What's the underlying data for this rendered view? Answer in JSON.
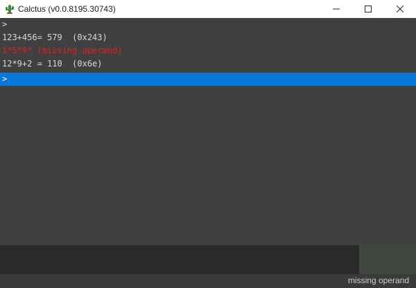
{
  "window": {
    "title": "Calctus (v0.0.8195.30743)",
    "icon": "cactus-icon",
    "controls": {
      "minimize": "—",
      "maximize": "☐",
      "close": "✕"
    }
  },
  "console": {
    "lines": [
      {
        "text": ">",
        "kind": "normal"
      },
      {
        "text": "123+456= 579  (0x243)",
        "kind": "normal"
      },
      {
        "text": "1*5*9* (missing operand)",
        "kind": "error"
      },
      {
        "text": "12*9+2 = 110  (0x6e)",
        "kind": "normal"
      },
      {
        "text": ">",
        "kind": "active"
      }
    ]
  },
  "status": {
    "message": "missing operand"
  },
  "colors": {
    "background": "#404040",
    "error": "#e81e1e",
    "active_line": "#0a78d7",
    "text": "#d8d8d8"
  }
}
